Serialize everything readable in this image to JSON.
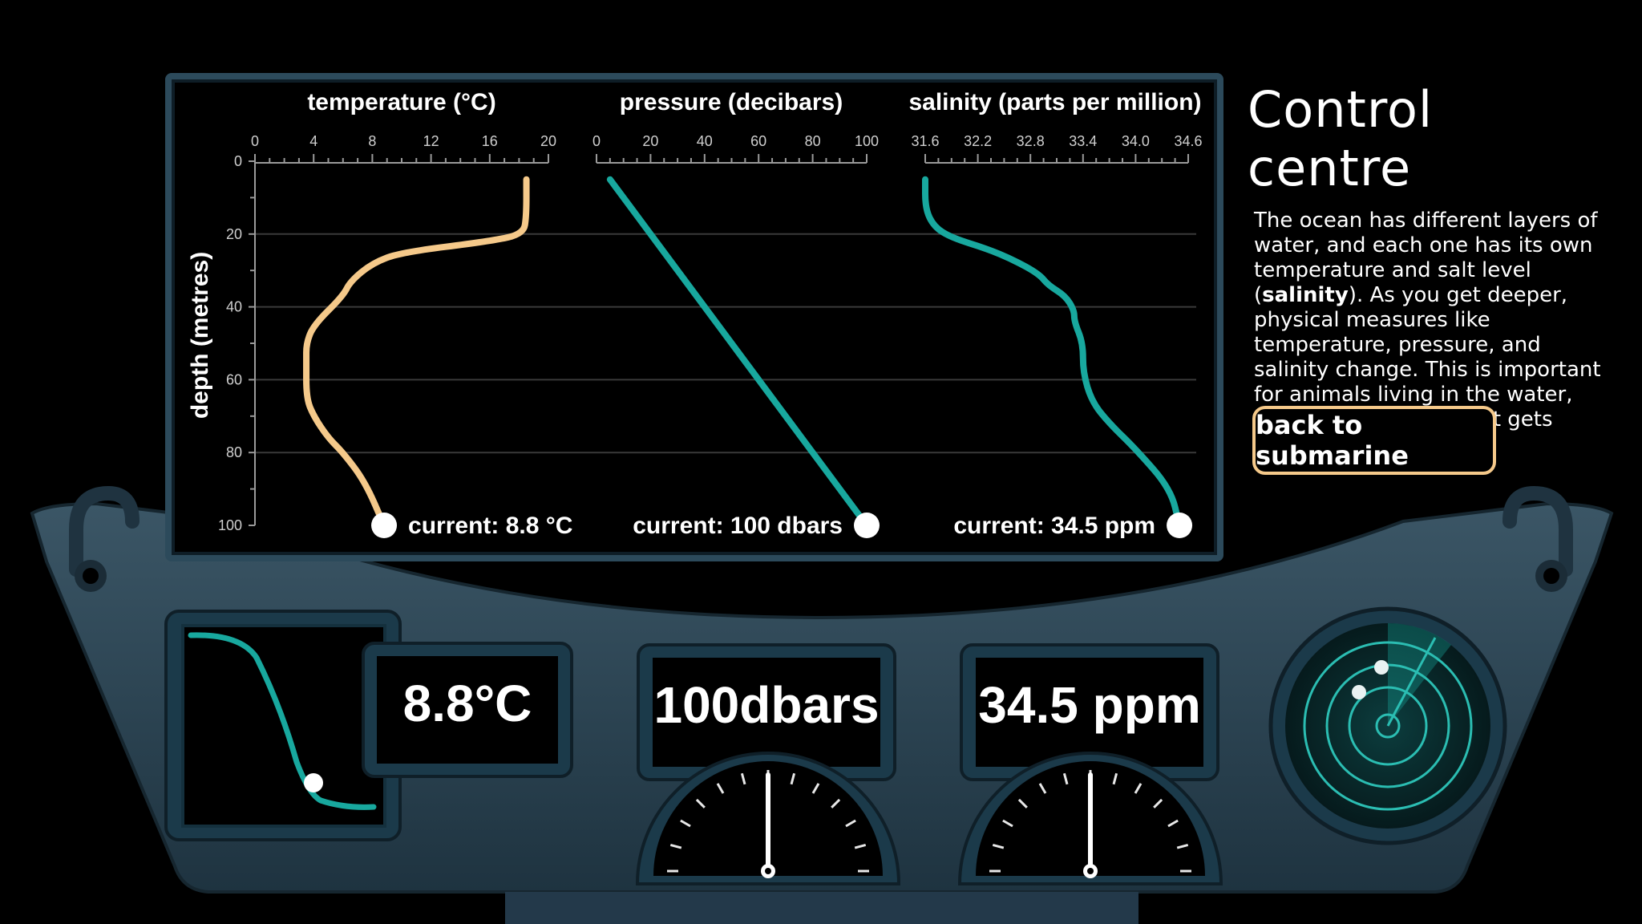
{
  "chart_data": [
    {
      "type": "line",
      "title": "temperature (°C)",
      "ylabel": "depth (metres)",
      "x_ticks": [
        "0",
        "4",
        "8",
        "12",
        "16",
        "20"
      ],
      "xlim": [
        0,
        20
      ],
      "y_ticks": [
        "0",
        "20",
        "40",
        "60",
        "80",
        "100"
      ],
      "ylim": [
        0,
        100
      ],
      "series": [
        {
          "color": "#f5c98a",
          "points": [
            [
              18.5,
              5
            ],
            [
              18.5,
              15
            ],
            [
              18.3,
              20
            ],
            [
              16,
              22
            ],
            [
              10,
              25
            ],
            [
              8,
              28
            ],
            [
              6.5,
              33
            ],
            [
              6,
              37
            ],
            [
              4,
              45
            ],
            [
              3.5,
              50
            ],
            [
              3.5,
              55
            ],
            [
              3.5,
              65
            ],
            [
              4,
              70
            ],
            [
              5,
              76
            ],
            [
              6,
              80
            ],
            [
              7.5,
              88
            ],
            [
              8.8,
              100
            ]
          ]
        }
      ],
      "current_label": "current: 8.8 °C"
    },
    {
      "type": "line",
      "title": "pressure (decibars)",
      "x_ticks": [
        "0",
        "20",
        "40",
        "60",
        "80",
        "100"
      ],
      "xlim": [
        0,
        100
      ],
      "series": [
        {
          "color": "#18a89e",
          "points": [
            [
              5,
              5
            ],
            [
              100,
              100
            ]
          ]
        }
      ],
      "current_label": "current: 100 dbars"
    },
    {
      "type": "line",
      "title": "salinity (parts per million)",
      "x_ticks": [
        "31.6",
        "32.2",
        "32.8",
        "33.4",
        "34.0",
        "34.6"
      ],
      "xlim": [
        31.6,
        34.6
      ],
      "series": [
        {
          "color": "#18a89e",
          "points": [
            [
              31.6,
              5
            ],
            [
              31.6,
              13
            ],
            [
              31.7,
              18
            ],
            [
              31.9,
              21
            ],
            [
              32.3,
              24
            ],
            [
              32.6,
              27
            ],
            [
              32.9,
              31
            ],
            [
              33.0,
              34
            ],
            [
              33.2,
              37
            ],
            [
              33.3,
              41
            ],
            [
              33.3,
              44
            ],
            [
              33.4,
              50
            ],
            [
              33.4,
              58
            ],
            [
              33.5,
              66
            ],
            [
              33.7,
              72
            ],
            [
              34.0,
              79
            ],
            [
              34.4,
              90
            ],
            [
              34.5,
              100
            ]
          ]
        }
      ],
      "current_label": "current: 34.5 ppm"
    }
  ],
  "colors": {
    "temperature": "#f5c98a",
    "pressure": "#18a89e",
    "salinity": "#18a89e",
    "panel": "#2e4756",
    "screen_border": "#2c4a5b"
  },
  "side_panel": {
    "title": "Control centre",
    "text_1": "The ocean has different layers of water, and each one has its own temperature and salt level (",
    "text_bold": "salinity",
    "text_2": "). As you get deeper, physical measures like temperature, pressure, and salinity change. This is important for animals living in the water, who need to adapt as it gets deeper.",
    "back_button": "back to submarine"
  },
  "dashboard": {
    "temperature_reading": "8.8°C",
    "pressure_reading": "100dbars",
    "salinity_reading": "34.5 ppm",
    "pressure_gauge_level": 0.5,
    "salinity_gauge_level": 0.5,
    "mini_graph_marker_level": 0.75,
    "icons": [
      "mini-temperature-graph-icon",
      "pressure-gauge-icon",
      "salinity-gauge-icon",
      "radar-icon"
    ]
  }
}
